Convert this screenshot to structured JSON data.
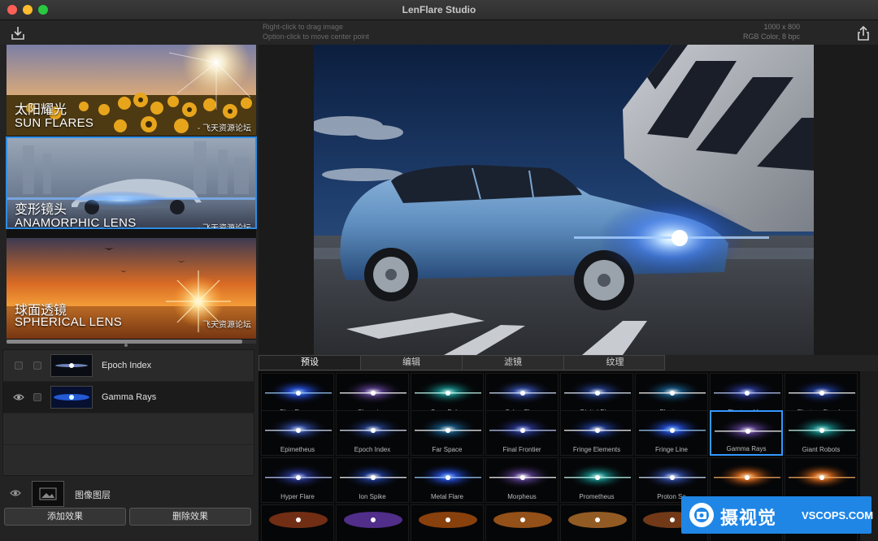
{
  "window": {
    "title": "LenFlare Studio"
  },
  "topbar": {
    "hint_line1": "Right-click to drag image",
    "hint_line2": "Option-click to move center point",
    "image_size": "1000 x 800",
    "image_mode": "RGB Color, 8 bpc",
    "import_icon": "download-icon",
    "share_icon": "share-icon"
  },
  "presets": [
    {
      "cn": "太阳耀光",
      "en": "SUN FLARES",
      "watermark": "- 飞天资源论坛"
    },
    {
      "cn": "变形镜头",
      "en": "ANAMORPHIC LENS",
      "watermark": "- 飞天资源论坛"
    },
    {
      "cn": "球面透镜",
      "en": "SPHERICAL LENS",
      "watermark": "飞天资源论坛"
    }
  ],
  "layers": [
    {
      "name": "Epoch Index"
    },
    {
      "name": "Gamma Rays"
    }
  ],
  "base_layer": {
    "name": "图像图层"
  },
  "buttons": {
    "add": "添加效果",
    "remove": "删除效果"
  },
  "tabs": [
    "预设",
    "编辑",
    "滤镜",
    "纹理"
  ],
  "tiles": [
    [
      "Blue Energy",
      "Chromium",
      "Cyan Pulse",
      "Cyber Flare",
      "Digital Blue",
      "Electron",
      "Electron Hex",
      "Electron Streaks"
    ],
    [
      "Epimetheus",
      "Epoch Index",
      "Far Space",
      "Final Frontier",
      "Fringe Elements",
      "Fringe Line",
      "Gamma Rays",
      "Giant Robots"
    ],
    [
      "Hyper Flare",
      "Ion Spike",
      "Metal Flare",
      "Morpheus",
      "Prometheus",
      "Proton So",
      "",
      ""
    ]
  ],
  "brand": {
    "cn": "摄视觉",
    "en": "VSCOPS.COM"
  }
}
